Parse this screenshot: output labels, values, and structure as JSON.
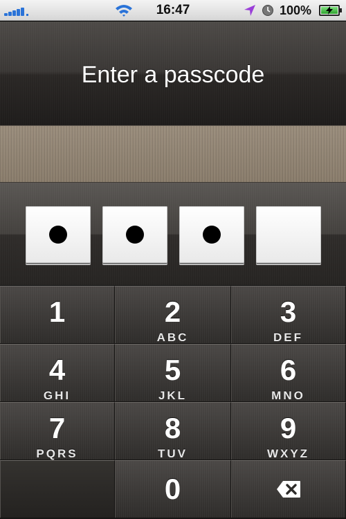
{
  "status_bar": {
    "time": "16:47",
    "battery_percent": "100%",
    "battery_level": 1.0,
    "signal_bars": 5,
    "icons": [
      "signal-icon",
      "wifi-icon",
      "location-arrow-icon",
      "clock-icon",
      "battery-charging-icon"
    ],
    "colors": {
      "signal": "#2a73d8",
      "location": "#9a3fd8",
      "battery": "#2ea32e"
    }
  },
  "header": {
    "title": "Enter a passcode"
  },
  "passcode": {
    "length": 4,
    "entered": 3
  },
  "keypad": {
    "keys": [
      {
        "digit": "1",
        "letters": ""
      },
      {
        "digit": "2",
        "letters": "ABC"
      },
      {
        "digit": "3",
        "letters": "DEF"
      },
      {
        "digit": "4",
        "letters": "GHI"
      },
      {
        "digit": "5",
        "letters": "JKL"
      },
      {
        "digit": "6",
        "letters": "MNO"
      },
      {
        "digit": "7",
        "letters": "PQRS"
      },
      {
        "digit": "8",
        "letters": "TUV"
      },
      {
        "digit": "9",
        "letters": "WXYZ"
      },
      {
        "digit": "0",
        "letters": ""
      }
    ],
    "delete_icon": "backspace-icon"
  }
}
